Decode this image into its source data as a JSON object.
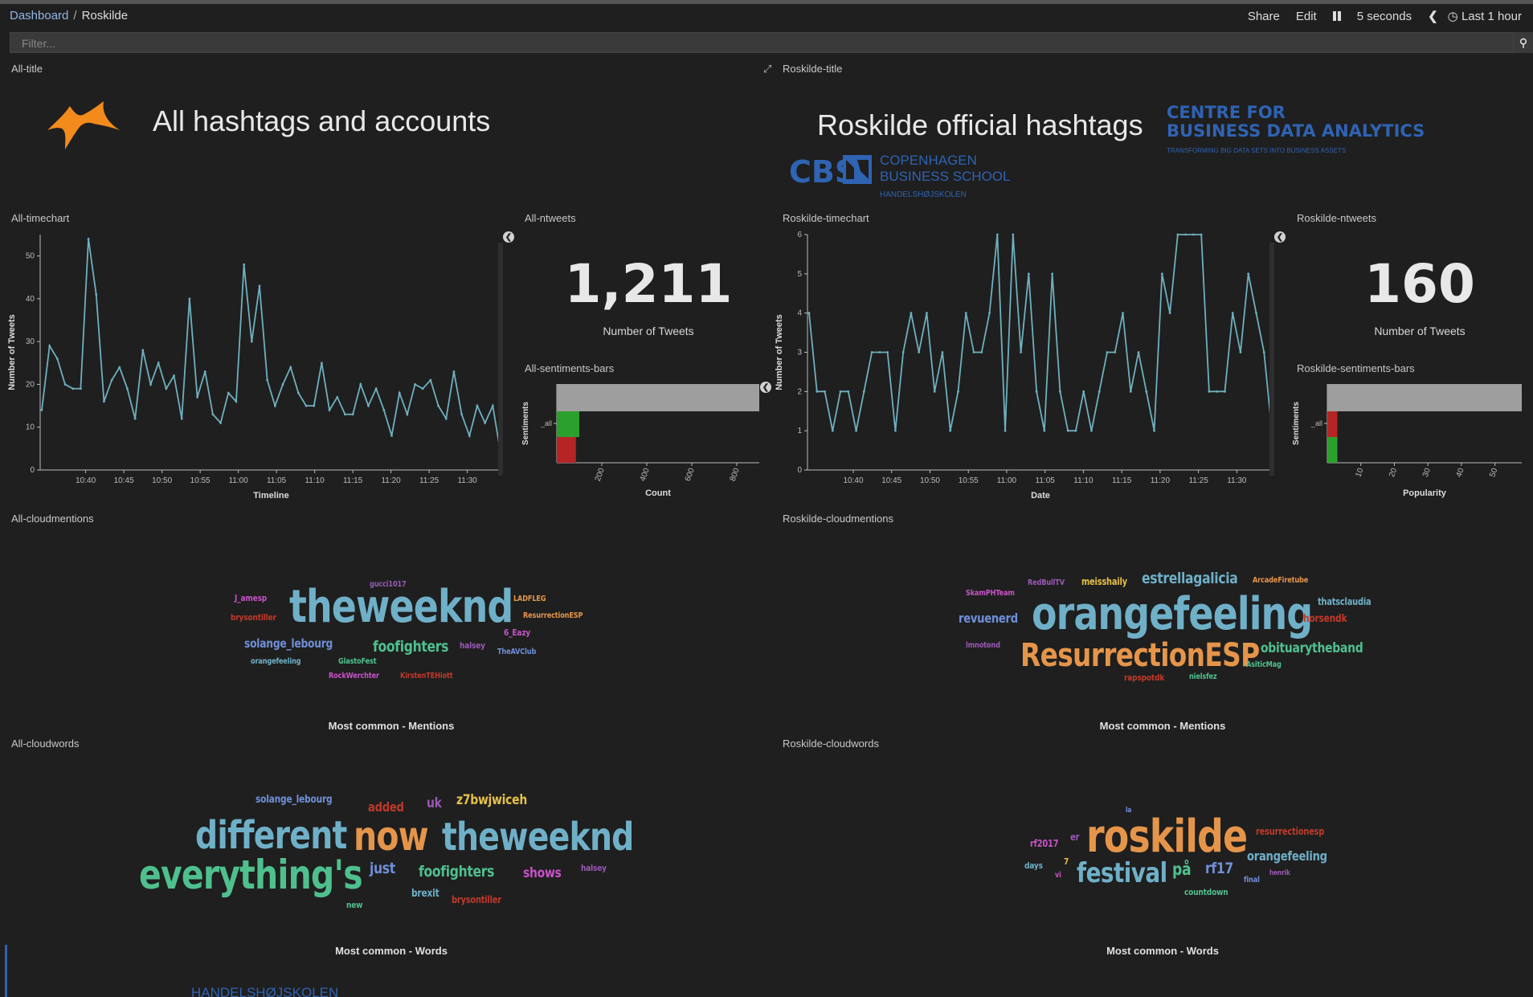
{
  "breadcrumb": {
    "root": "Dashboard",
    "current": "Roskilde"
  },
  "toolbar": {
    "share": "Share",
    "edit": "Edit",
    "pause_icon": "pause-icon",
    "interval": "5 seconds",
    "back_icon": "chevron-left-icon",
    "time_icon": "clock-icon",
    "time_range": "Last 1 hour"
  },
  "filter": {
    "placeholder": "Filter...",
    "icon": "search-icon"
  },
  "all_title_panel": {
    "panel_title": "All-title",
    "heading": "All hashtags and accounts",
    "logo_icon": "orange-star-logo"
  },
  "roskilde_title_panel": {
    "panel_title": "Roskilde-title",
    "expand_icon": "expand-icon",
    "heading": "Roskilde official hashtags",
    "logo_centre_line1": "CENTRE FOR",
    "logo_centre_line2": "BUSINESS DATA ANALYTICS",
    "logo_centre_tagline": "TRANSFORMING BIG DATA SETS INTO BUSINESS ASSETS",
    "logo_cbs": "CBS",
    "logo_copenhagen": "COPENHAGEN",
    "logo_business_school": "BUSINESS SCHOOL",
    "logo_handels": "HANDELSHØJSKOLEN",
    "logo_color": "#2f63b3"
  },
  "all_timechart": {
    "panel_title": "All-timechart",
    "legend_toggle_icon": "chevron-left-icon",
    "chart_data": {
      "type": "line",
      "title": "",
      "xlabel": "Timeline",
      "ylabel": "Number of Tweets",
      "ylim": [
        0,
        55
      ],
      "yticks": [
        "0",
        "10",
        "20",
        "30",
        "40",
        "50"
      ],
      "xticks": [
        "10:40",
        "10:45",
        "10:50",
        "10:55",
        "11:00",
        "11:05",
        "11:10",
        "11:15",
        "11:20",
        "11:25",
        "11:30"
      ],
      "series": [
        {
          "color": "#6fb0bf",
          "values": [
            14,
            29,
            26,
            20,
            19,
            19,
            54,
            41,
            16,
            21,
            24,
            19,
            12,
            28,
            20,
            25,
            19,
            22,
            12,
            40,
            17,
            23,
            13,
            11,
            18,
            16,
            48,
            30,
            43,
            21,
            15,
            20,
            24,
            18,
            15,
            15,
            25,
            14,
            17,
            13,
            13,
            20,
            15,
            19,
            14,
            8,
            18,
            13,
            20,
            19,
            21,
            15,
            12,
            23,
            13,
            8,
            15,
            11,
            15,
            4
          ]
        }
      ],
      "x_start": "10:35",
      "x_step_minutes": 1,
      "line_color": "#6fb0bf"
    }
  },
  "all_ntweets": {
    "panel_title": "All-ntweets",
    "value": "1,211",
    "label": "Number of Tweets"
  },
  "all_sentiments": {
    "panel_title": "All-sentiments-bars",
    "chart_data": {
      "type": "bar",
      "orientation": "horizontal",
      "xlabel": "Count",
      "ylabel": "Sentiments",
      "category": "_all",
      "xlim": [
        0,
        900
      ],
      "xticks": [
        "200",
        "400",
        "600",
        "800"
      ],
      "series": [
        {
          "color": "#9e9e9e",
          "value": 900
        },
        {
          "color": "#2ca02c",
          "value": 100
        },
        {
          "color": "#b52525",
          "value": 85
        }
      ]
    }
  },
  "roskilde_timechart": {
    "panel_title": "Roskilde-timechart",
    "legend_toggle_icon": "chevron-left-icon",
    "chart_data": {
      "type": "line",
      "title": "",
      "xlabel": "Date",
      "ylabel": "Number of Tweets",
      "ylim": [
        0,
        6
      ],
      "yticks": [
        "0",
        "1",
        "2",
        "3",
        "4",
        "5",
        "6"
      ],
      "xticks": [
        "10:40",
        "10:45",
        "10:50",
        "10:55",
        "11:00",
        "11:05",
        "11:10",
        "11:15",
        "11:20",
        "11:25",
        "11:30"
      ],
      "series": [
        {
          "color": "#6fb0bf",
          "values": [
            4,
            2,
            2,
            1,
            2,
            2,
            1,
            2,
            3,
            3,
            3,
            1,
            3,
            4,
            3,
            4,
            2,
            3,
            1,
            2,
            4,
            3,
            3,
            4,
            6,
            1,
            6,
            3,
            5,
            2,
            1,
            5,
            2,
            1,
            1,
            2,
            1,
            2,
            3,
            3,
            4,
            2,
            3,
            2,
            1,
            5,
            4,
            6,
            6,
            6,
            6,
            2,
            2,
            2,
            4,
            3,
            5,
            4,
            3,
            1
          ]
        }
      ],
      "x_start": "10:34",
      "x_step_minutes": 1,
      "line_color": "#6fb0bf"
    }
  },
  "roskilde_ntweets": {
    "panel_title": "Roskilde-ntweets",
    "value": "160",
    "label": "Number of Tweets"
  },
  "roskilde_sentiments": {
    "panel_title": "Roskilde-sentiments-bars",
    "chart_data": {
      "type": "bar",
      "orientation": "horizontal",
      "xlabel": "Popularity",
      "ylabel": "Sentiments",
      "category": "_all",
      "xlim": [
        0,
        58
      ],
      "xticks": [
        "10",
        "20",
        "30",
        "40",
        "50"
      ],
      "series": [
        {
          "color": "#9e9e9e",
          "value": 58
        },
        {
          "color": "#b52525",
          "value": 3
        },
        {
          "color": "#2ca02c",
          "value": 3
        }
      ]
    }
  },
  "all_cloudmentions": {
    "panel_title": "All-cloudmentions",
    "label": "Most common - Mentions",
    "words": [
      {
        "text": "theweeknd",
        "color": "#6fb0c8",
        "size": 56
      },
      {
        "text": "gucci1017",
        "color": "#9b59b6",
        "size": 10
      },
      {
        "text": "J_amesp",
        "color": "#c853c8",
        "size": 11
      },
      {
        "text": "brysontiller",
        "color": "#c0392b",
        "size": 11
      },
      {
        "text": "LADFLEG",
        "color": "#e5954a",
        "size": 10
      },
      {
        "text": "ResurrectionESP",
        "color": "#e5954a",
        "size": 10
      },
      {
        "text": "6_Eazy",
        "color": "#c853c8",
        "size": 11
      },
      {
        "text": "solange_lebourg",
        "color": "#6f8fd8",
        "size": 15
      },
      {
        "text": "foofighters",
        "color": "#4fc08d",
        "size": 19
      },
      {
        "text": "halsey",
        "color": "#9b59b6",
        "size": 11
      },
      {
        "text": "TheAVClub",
        "color": "#6f8fd8",
        "size": 10
      },
      {
        "text": "orangefeeling",
        "color": "#6fb0c8",
        "size": 10
      },
      {
        "text": "GlastoFest",
        "color": "#4fc08d",
        "size": 10
      },
      {
        "text": "RockWerchter",
        "color": "#c853c8",
        "size": 10
      },
      {
        "text": "KirstenTEHiott",
        "color": "#c0392b",
        "size": 10
      }
    ]
  },
  "roskilde_cloudmentions": {
    "panel_title": "Roskilde-cloudmentions",
    "label": "Most common - Mentions",
    "words": [
      {
        "text": "orangefeeling",
        "color": "#6fb0c8",
        "size": 56
      },
      {
        "text": "ResurrectionESP",
        "color": "#e5954a",
        "size": 40
      },
      {
        "text": "RedBullTV",
        "color": "#9b59b6",
        "size": 10
      },
      {
        "text": "meisshaily",
        "color": "#e5c04a",
        "size": 12
      },
      {
        "text": "estrellagalicia",
        "color": "#6fb0c8",
        "size": 19
      },
      {
        "text": "ArcadeFiretube",
        "color": "#e5954a",
        "size": 10
      },
      {
        "text": "SkamPHTeam",
        "color": "#c853c8",
        "size": 10
      },
      {
        "text": "thatsclaudia",
        "color": "#6fb0c8",
        "size": 12
      },
      {
        "text": "revuenerd",
        "color": "#6f8fd8",
        "size": 16
      },
      {
        "text": "horsendk",
        "color": "#c0392b",
        "size": 13
      },
      {
        "text": "lmnotond",
        "color": "#9b59b6",
        "size": 10
      },
      {
        "text": "obituarytheband",
        "color": "#4fc08d",
        "size": 17
      },
      {
        "text": "AsiticMag",
        "color": "#4fc08d",
        "size": 10
      },
      {
        "text": "rapspotdk",
        "color": "#c0392b",
        "size": 11
      },
      {
        "text": "nielsfez",
        "color": "#4fc08d",
        "size": 10
      }
    ]
  },
  "all_cloudwords": {
    "panel_title": "All-cloudwords",
    "label": "Most common - Words",
    "words": [
      {
        "text": "solange_lebourg",
        "color": "#6f8fd8",
        "size": 13
      },
      {
        "text": "added",
        "color": "#c0392b",
        "size": 16
      },
      {
        "text": "uk",
        "color": "#9b59b6",
        "size": 17
      },
      {
        "text": "z7bwjwiceh",
        "color": "#e5c04a",
        "size": 17
      },
      {
        "text": "different",
        "color": "#6fb0c8",
        "size": 48
      },
      {
        "text": "now",
        "color": "#e5954a",
        "size": 50
      },
      {
        "text": "theweeknd",
        "color": "#6fb0c8",
        "size": 48
      },
      {
        "text": "everything's",
        "color": "#4fc08d",
        "size": 50
      },
      {
        "text": "just",
        "color": "#6f8fd8",
        "size": 19
      },
      {
        "text": "foofighters",
        "color": "#4fc08d",
        "size": 19
      },
      {
        "text": "shows",
        "color": "#c853c8",
        "size": 17
      },
      {
        "text": "halsey",
        "color": "#9b59b6",
        "size": 11
      },
      {
        "text": "brexit",
        "color": "#6fb0c8",
        "size": 13
      },
      {
        "text": "brysontiller",
        "color": "#c0392b",
        "size": 12
      },
      {
        "text": "new",
        "color": "#4fc08d",
        "size": 11
      }
    ]
  },
  "roskilde_cloudwords": {
    "panel_title": "Roskilde-cloudwords",
    "label": "Most common - Words",
    "words": [
      {
        "text": "la",
        "color": "#6f8fd8",
        "size": 9
      },
      {
        "text": "roskilde",
        "color": "#e5954a",
        "size": 56
      },
      {
        "text": "rf2017",
        "color": "#c853c8",
        "size": 12
      },
      {
        "text": "er",
        "color": "#9b59b6",
        "size": 12
      },
      {
        "text": "resurrectionesp",
        "color": "#c0392b",
        "size": 12
      },
      {
        "text": "7",
        "color": "#e5c04a",
        "size": 11
      },
      {
        "text": "days",
        "color": "#6fb0c8",
        "size": 11
      },
      {
        "text": "vi",
        "color": "#c853c8",
        "size": 10
      },
      {
        "text": "festival",
        "color": "#6fb0c8",
        "size": 34
      },
      {
        "text": "på",
        "color": "#4fc08d",
        "size": 21
      },
      {
        "text": "rf17",
        "color": "#6f8fd8",
        "size": 19
      },
      {
        "text": "orangefeeling",
        "color": "#6fb0c8",
        "size": 16
      },
      {
        "text": "henrik",
        "color": "#9b59b6",
        "size": 9
      },
      {
        "text": "final",
        "color": "#6f8fd8",
        "size": 10
      },
      {
        "text": "countdown",
        "color": "#4fc08d",
        "size": 11
      }
    ]
  }
}
